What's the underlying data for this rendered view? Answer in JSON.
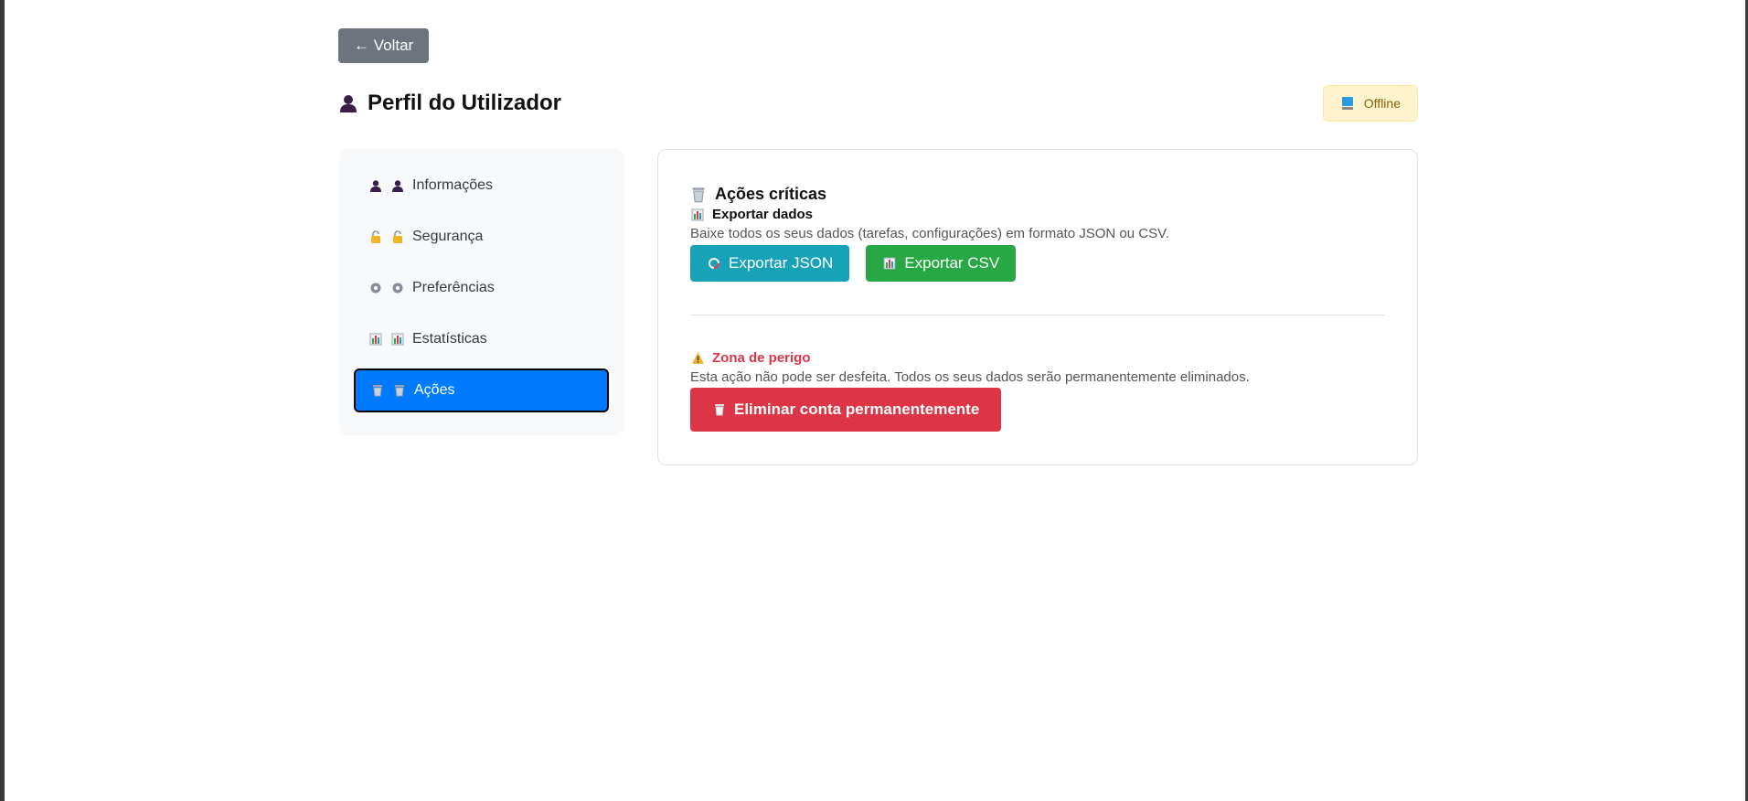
{
  "back_button": {
    "label": "← Voltar"
  },
  "header": {
    "title": "Perfil do Utilizador",
    "title_icon": "user-icon",
    "status": {
      "label": "Offline",
      "icon": "computer-icon",
      "bg": "#fff3cd",
      "color": "#856404"
    }
  },
  "sidebar": {
    "items": [
      {
        "label": "Informações",
        "icon": "user-icon",
        "active": false
      },
      {
        "label": "Segurança",
        "icon": "lock-icon",
        "active": false
      },
      {
        "label": "Preferências",
        "icon": "gear-icon",
        "active": false
      },
      {
        "label": "Estatísticas",
        "icon": "bar-chart-icon",
        "active": false
      },
      {
        "label": "Ações",
        "icon": "trash-icon",
        "active": true
      }
    ]
  },
  "panel": {
    "title": "Ações críticas",
    "export": {
      "title": "Exportar dados",
      "description": "Baixe todos os seus dados (tarefas, configurações) em formato JSON ou CSV.",
      "json_button": "Exportar JSON",
      "csv_button": "Exportar CSV"
    },
    "danger": {
      "title": "Zona de perigo",
      "description": "Esta ação não pode ser desfeita. Todos os seus dados serão permanentemente eliminados.",
      "delete_button": "Eliminar conta permanentemente"
    }
  },
  "colors": {
    "primary": "#007bff",
    "secondary": "#6c757d",
    "info": "#17a2b8",
    "success": "#28a745",
    "danger": "#dc3545"
  }
}
